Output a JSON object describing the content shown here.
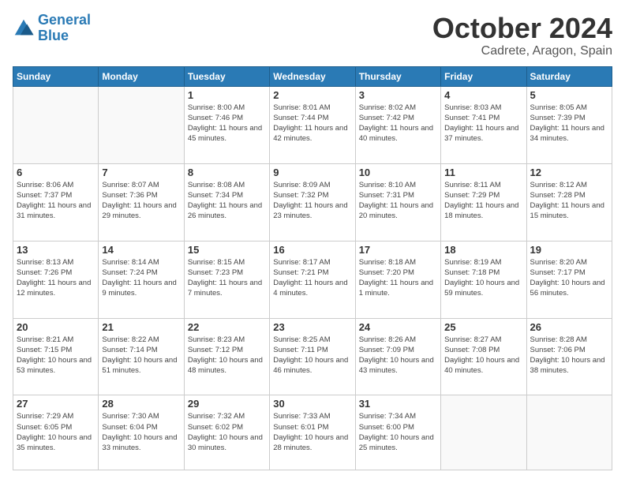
{
  "logo": {
    "line1": "General",
    "line2": "Blue"
  },
  "header": {
    "month": "October 2024",
    "location": "Cadrete, Aragon, Spain"
  },
  "days_of_week": [
    "Sunday",
    "Monday",
    "Tuesday",
    "Wednesday",
    "Thursday",
    "Friday",
    "Saturday"
  ],
  "weeks": [
    [
      {
        "day": "",
        "info": ""
      },
      {
        "day": "",
        "info": ""
      },
      {
        "day": "1",
        "info": "Sunrise: 8:00 AM\nSunset: 7:46 PM\nDaylight: 11 hours and 45 minutes."
      },
      {
        "day": "2",
        "info": "Sunrise: 8:01 AM\nSunset: 7:44 PM\nDaylight: 11 hours and 42 minutes."
      },
      {
        "day": "3",
        "info": "Sunrise: 8:02 AM\nSunset: 7:42 PM\nDaylight: 11 hours and 40 minutes."
      },
      {
        "day": "4",
        "info": "Sunrise: 8:03 AM\nSunset: 7:41 PM\nDaylight: 11 hours and 37 minutes."
      },
      {
        "day": "5",
        "info": "Sunrise: 8:05 AM\nSunset: 7:39 PM\nDaylight: 11 hours and 34 minutes."
      }
    ],
    [
      {
        "day": "6",
        "info": "Sunrise: 8:06 AM\nSunset: 7:37 PM\nDaylight: 11 hours and 31 minutes."
      },
      {
        "day": "7",
        "info": "Sunrise: 8:07 AM\nSunset: 7:36 PM\nDaylight: 11 hours and 29 minutes."
      },
      {
        "day": "8",
        "info": "Sunrise: 8:08 AM\nSunset: 7:34 PM\nDaylight: 11 hours and 26 minutes."
      },
      {
        "day": "9",
        "info": "Sunrise: 8:09 AM\nSunset: 7:32 PM\nDaylight: 11 hours and 23 minutes."
      },
      {
        "day": "10",
        "info": "Sunrise: 8:10 AM\nSunset: 7:31 PM\nDaylight: 11 hours and 20 minutes."
      },
      {
        "day": "11",
        "info": "Sunrise: 8:11 AM\nSunset: 7:29 PM\nDaylight: 11 hours and 18 minutes."
      },
      {
        "day": "12",
        "info": "Sunrise: 8:12 AM\nSunset: 7:28 PM\nDaylight: 11 hours and 15 minutes."
      }
    ],
    [
      {
        "day": "13",
        "info": "Sunrise: 8:13 AM\nSunset: 7:26 PM\nDaylight: 11 hours and 12 minutes."
      },
      {
        "day": "14",
        "info": "Sunrise: 8:14 AM\nSunset: 7:24 PM\nDaylight: 11 hours and 9 minutes."
      },
      {
        "day": "15",
        "info": "Sunrise: 8:15 AM\nSunset: 7:23 PM\nDaylight: 11 hours and 7 minutes."
      },
      {
        "day": "16",
        "info": "Sunrise: 8:17 AM\nSunset: 7:21 PM\nDaylight: 11 hours and 4 minutes."
      },
      {
        "day": "17",
        "info": "Sunrise: 8:18 AM\nSunset: 7:20 PM\nDaylight: 11 hours and 1 minute."
      },
      {
        "day": "18",
        "info": "Sunrise: 8:19 AM\nSunset: 7:18 PM\nDaylight: 10 hours and 59 minutes."
      },
      {
        "day": "19",
        "info": "Sunrise: 8:20 AM\nSunset: 7:17 PM\nDaylight: 10 hours and 56 minutes."
      }
    ],
    [
      {
        "day": "20",
        "info": "Sunrise: 8:21 AM\nSunset: 7:15 PM\nDaylight: 10 hours and 53 minutes."
      },
      {
        "day": "21",
        "info": "Sunrise: 8:22 AM\nSunset: 7:14 PM\nDaylight: 10 hours and 51 minutes."
      },
      {
        "day": "22",
        "info": "Sunrise: 8:23 AM\nSunset: 7:12 PM\nDaylight: 10 hours and 48 minutes."
      },
      {
        "day": "23",
        "info": "Sunrise: 8:25 AM\nSunset: 7:11 PM\nDaylight: 10 hours and 46 minutes."
      },
      {
        "day": "24",
        "info": "Sunrise: 8:26 AM\nSunset: 7:09 PM\nDaylight: 10 hours and 43 minutes."
      },
      {
        "day": "25",
        "info": "Sunrise: 8:27 AM\nSunset: 7:08 PM\nDaylight: 10 hours and 40 minutes."
      },
      {
        "day": "26",
        "info": "Sunrise: 8:28 AM\nSunset: 7:06 PM\nDaylight: 10 hours and 38 minutes."
      }
    ],
    [
      {
        "day": "27",
        "info": "Sunrise: 7:29 AM\nSunset: 6:05 PM\nDaylight: 10 hours and 35 minutes."
      },
      {
        "day": "28",
        "info": "Sunrise: 7:30 AM\nSunset: 6:04 PM\nDaylight: 10 hours and 33 minutes."
      },
      {
        "day": "29",
        "info": "Sunrise: 7:32 AM\nSunset: 6:02 PM\nDaylight: 10 hours and 30 minutes."
      },
      {
        "day": "30",
        "info": "Sunrise: 7:33 AM\nSunset: 6:01 PM\nDaylight: 10 hours and 28 minutes."
      },
      {
        "day": "31",
        "info": "Sunrise: 7:34 AM\nSunset: 6:00 PM\nDaylight: 10 hours and 25 minutes."
      },
      {
        "day": "",
        "info": ""
      },
      {
        "day": "",
        "info": ""
      }
    ]
  ]
}
